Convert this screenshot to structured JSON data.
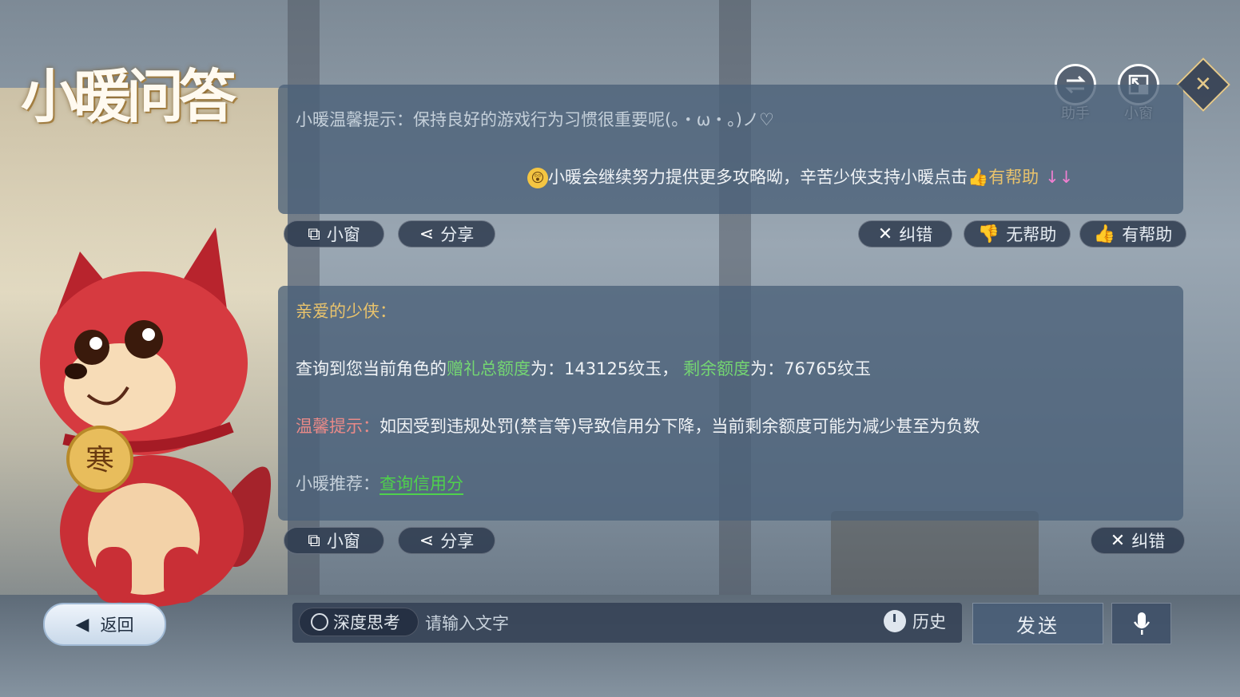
{
  "header": {
    "title": "小暖问答"
  },
  "top_buttons": {
    "assistant_label": "助手",
    "mini_window_label": "小窗"
  },
  "panel1": {
    "tip": "小暖温馨提示：保持良好的游戏行为习惯很重要呢(。・ω・。)ノ♡",
    "support_text": "小暖会继续努力提供更多攻略呦，辛苦少侠支持小暖点击",
    "helpful_highlight": "有帮助",
    "arrows": "↓↓"
  },
  "actions1": {
    "mini_window": "小窗",
    "share": "分享",
    "correct": "纠错",
    "not_helpful": "无帮助",
    "helpful": "有帮助"
  },
  "panel2": {
    "greeting": "亲爱的少侠：",
    "query_prefix": "查询到您当前角色的",
    "total_label": "赠礼总额度",
    "total_mid": "为：143125纹玉，",
    "remain_label": "剩余额度",
    "remain_value": "为：76765纹玉",
    "warm_label": "温馨提示：",
    "warm_text": "如因受到违规处罚(禁言等)导致信用分下降，当前剩余额度可能为减少甚至为负数",
    "recommend_label": "小暖推荐：",
    "recommend_link": "查询信用分"
  },
  "actions2": {
    "mini_window": "小窗",
    "share": "分享",
    "correct": "纠错"
  },
  "mascot": {
    "tag_char": "寒"
  },
  "bottom": {
    "back": "返回",
    "deep_think": "深度思考",
    "placeholder": "请输入文字",
    "history": "历史",
    "send": "发送"
  }
}
